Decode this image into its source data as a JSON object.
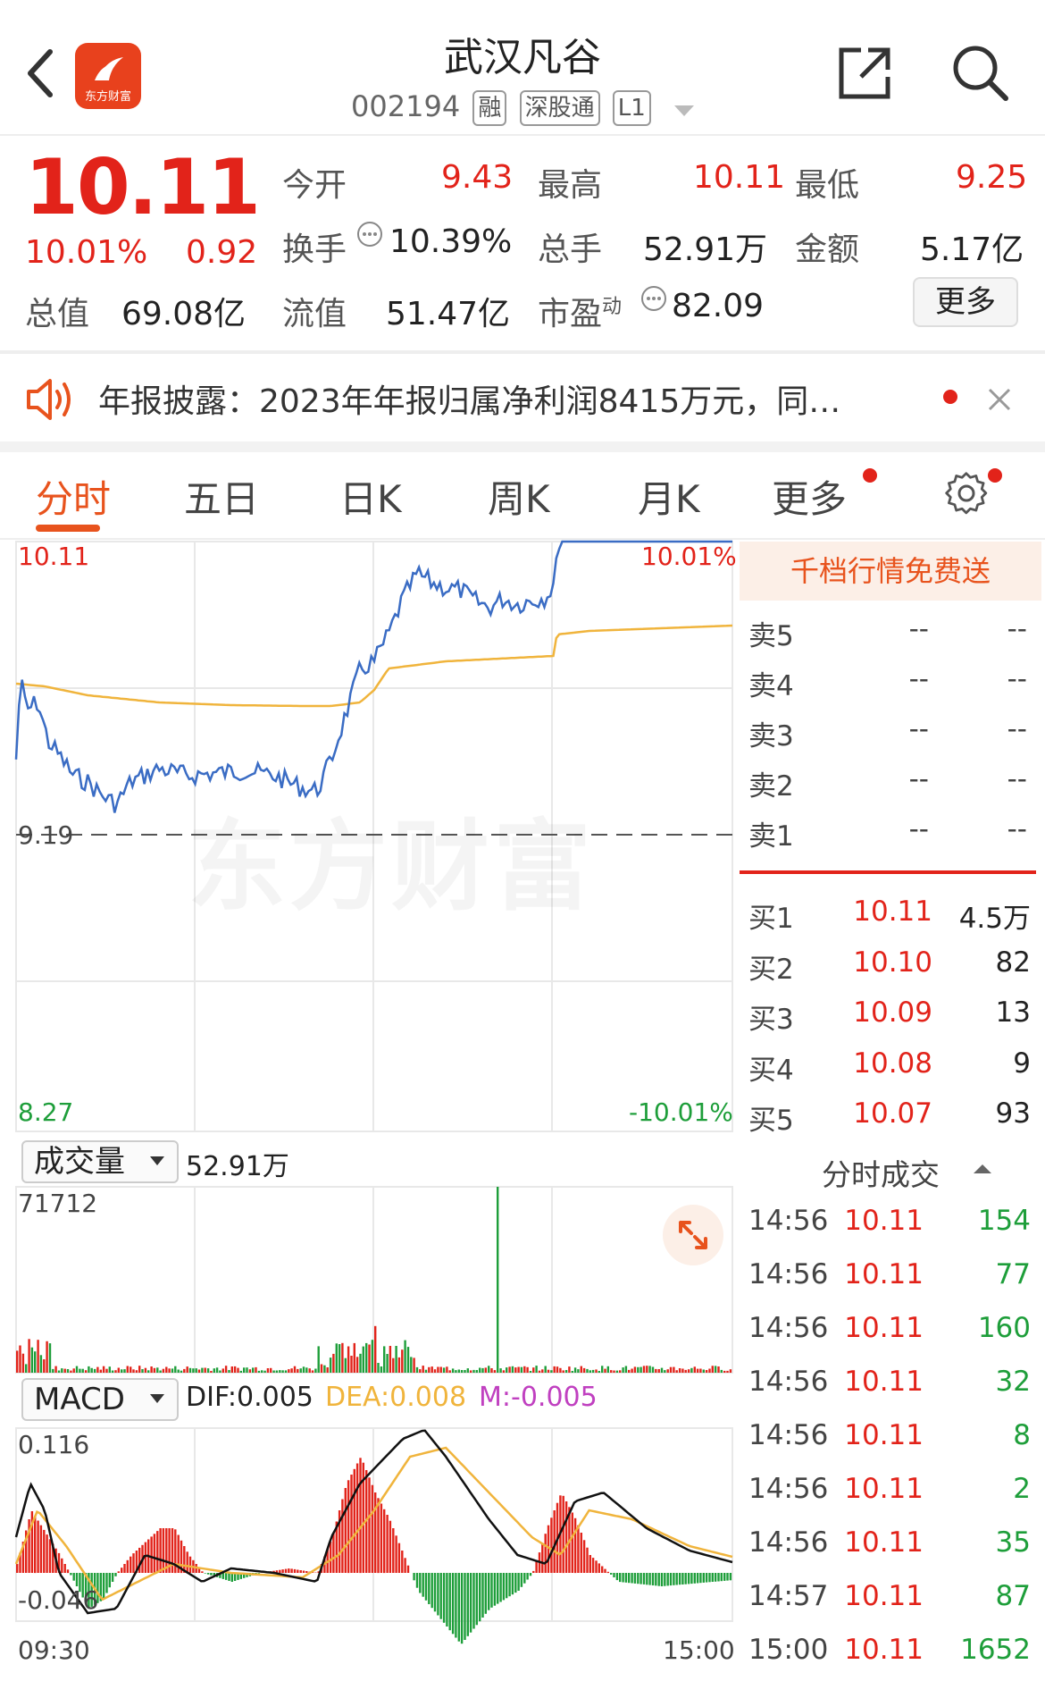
{
  "header": {
    "title": "武汉凡谷",
    "code": "002194",
    "tags": [
      "融",
      "深股通",
      "L1"
    ],
    "logo_text": "东方财富"
  },
  "quote": {
    "price": "10.11",
    "change_pct": "10.01%",
    "change": "0.92",
    "open_label": "今开",
    "open": "9.43",
    "high_label": "最高",
    "high": "10.11",
    "low_label": "最低",
    "low": "9.25",
    "turnover_label": "换手",
    "turnover": "10.39%",
    "volume_label": "总手",
    "volume": "52.91万",
    "amount_label": "金额",
    "amount": "5.17亿",
    "mktcap_label": "总值",
    "mktcap": "69.08亿",
    "float_label": "流值",
    "float": "51.47亿",
    "pe_label": "市盈",
    "pe_sup": "动",
    "pe": "82.09",
    "more_button": "更多"
  },
  "news": {
    "text": "年报披露：2023年年报归属净利润8415万元，同…"
  },
  "tabs": [
    "分时",
    "五日",
    "日K",
    "周K",
    "月K",
    "更多"
  ],
  "chart": {
    "y_top": "10.11",
    "y_mid": "9.19",
    "y_bottom": "8.27",
    "pct_top": "10.01%",
    "pct_bottom": "-10.01%",
    "watermark": "东方财富",
    "volume_selector": "成交量",
    "volume_total": "52.91万",
    "volume_max": "71712",
    "macd_selector": "MACD",
    "dif": "DIF:0.005",
    "dea": "DEA:0.008",
    "m": "M:-0.005",
    "macd_top": "0.116",
    "macd_bottom": "-0.046",
    "time_start": "09:30",
    "time_end": "15:00"
  },
  "orderbook": {
    "promo": "千档行情免费送",
    "asks": [
      {
        "label": "卖5",
        "price": "--",
        "vol": "--"
      },
      {
        "label": "卖4",
        "price": "--",
        "vol": "--"
      },
      {
        "label": "卖3",
        "price": "--",
        "vol": "--"
      },
      {
        "label": "卖2",
        "price": "--",
        "vol": "--"
      },
      {
        "label": "卖1",
        "price": "--",
        "vol": "--"
      }
    ],
    "bids": [
      {
        "label": "买1",
        "price": "10.11",
        "vol": "4.5万"
      },
      {
        "label": "买2",
        "price": "10.10",
        "vol": "82"
      },
      {
        "label": "买3",
        "price": "10.09",
        "vol": "13"
      },
      {
        "label": "买4",
        "price": "10.08",
        "vol": "9"
      },
      {
        "label": "买5",
        "price": "10.07",
        "vol": "93"
      }
    ],
    "ticks_title": "分时成交",
    "ticks": [
      {
        "time": "14:56",
        "price": "10.11",
        "vol": "154"
      },
      {
        "time": "14:56",
        "price": "10.11",
        "vol": "77"
      },
      {
        "time": "14:56",
        "price": "10.11",
        "vol": "160"
      },
      {
        "time": "14:56",
        "price": "10.11",
        "vol": "32"
      },
      {
        "time": "14:56",
        "price": "10.11",
        "vol": "8"
      },
      {
        "time": "14:56",
        "price": "10.11",
        "vol": "2"
      },
      {
        "time": "14:56",
        "price": "10.11",
        "vol": "35"
      },
      {
        "time": "14:57",
        "price": "10.11",
        "vol": "87"
      },
      {
        "time": "15:00",
        "price": "10.11",
        "vol": "1652"
      }
    ]
  },
  "colors": {
    "up": "#e2231a",
    "down": "#1e9e3a",
    "price_line": "#3a6cc4",
    "avg_line": "#f0b43c",
    "accent": "#e8531d"
  }
}
